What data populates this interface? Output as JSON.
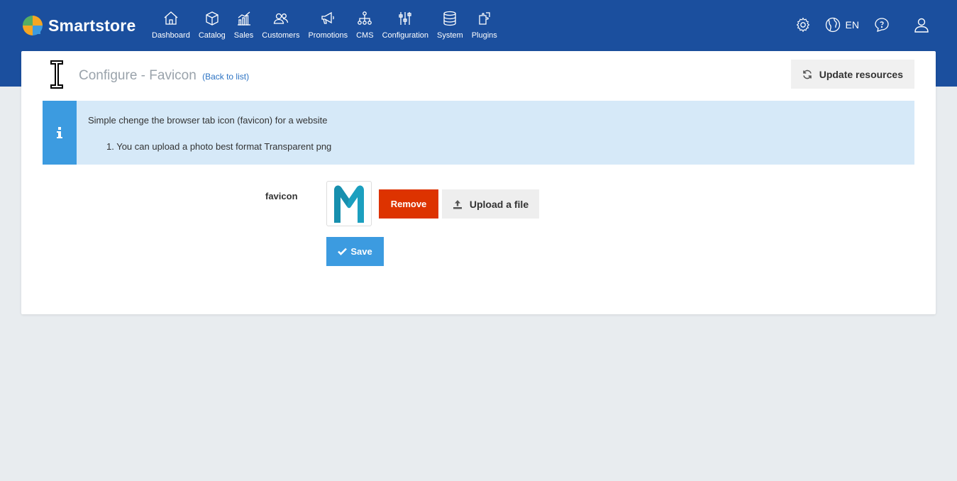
{
  "brand": {
    "name": "Smartstore"
  },
  "nav": {
    "items": [
      {
        "label": "Dashboard",
        "icon": "home-icon"
      },
      {
        "label": "Catalog",
        "icon": "cube-icon"
      },
      {
        "label": "Sales",
        "icon": "chart-icon"
      },
      {
        "label": "Customers",
        "icon": "users-icon"
      },
      {
        "label": "Promotions",
        "icon": "megaphone-icon"
      },
      {
        "label": "CMS",
        "icon": "sitemap-icon"
      },
      {
        "label": "Configuration",
        "icon": "sliders-icon"
      },
      {
        "label": "System",
        "icon": "database-icon"
      },
      {
        "label": "Plugins",
        "icon": "puzzle-icon"
      }
    ]
  },
  "header_right": {
    "language": "EN"
  },
  "page": {
    "title": "Configure - Favicon",
    "back_link": "(Back to list)",
    "update_button": "Update resources"
  },
  "alert": {
    "text": "Simple chenge the browser tab icon (favicon) for a website",
    "list_item": "1. You can upload a photo best format Transparent png"
  },
  "form": {
    "field_label": "favicon",
    "remove_button": "Remove",
    "upload_button": "Upload a file",
    "save_button": "Save"
  },
  "colors": {
    "topbar": "#1b4f9e",
    "remove": "#dd3300",
    "primary": "#3c9be0",
    "alert_bg": "#d6e9f8"
  }
}
